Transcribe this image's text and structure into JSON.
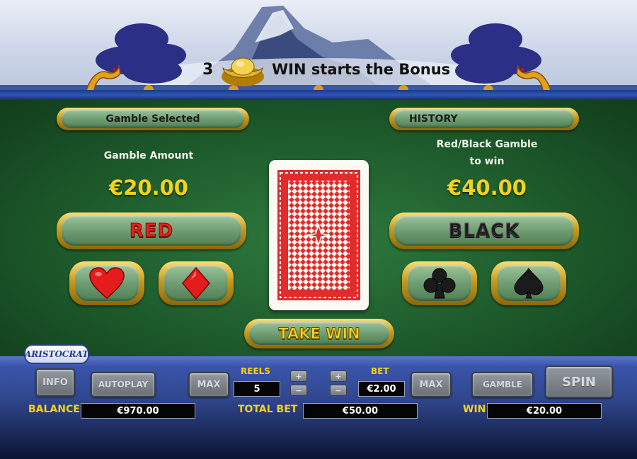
{
  "banner": {
    "count": "3",
    "text": "WIN starts the Bonus",
    "icon": "gold-ingot-icon"
  },
  "gamble": {
    "header_label": "Gamble Selected",
    "history_label": "HISTORY",
    "amount_label": "Gamble Amount",
    "amount_value": "€20.00",
    "to_win_line1": "Red/Black Gamble",
    "to_win_line2": "to win",
    "to_win_value": "€40.00",
    "red_label": "RED",
    "black_label": "BLACK",
    "take_win_label": "TAKE WIN",
    "suits": [
      "heart-icon",
      "diamond-icon",
      "club-icon",
      "spade-icon"
    ]
  },
  "controls": {
    "logo": "ARISTOCRAT",
    "info_label": "INFO",
    "autoplay_label": "AUTOPLAY",
    "max_label": "MAX",
    "reels_label": "REELS",
    "reels_value": "5",
    "bet_label": "BET",
    "bet_value": "€2.00",
    "plus": "+",
    "minus": "−",
    "gamble_label": "GAMBLE",
    "spin_label": "SPIN",
    "balance_label": "BALANCE",
    "balance_value": "€970.00",
    "total_bet_label": "TOTAL BET",
    "total_bet_value": "€50.00",
    "win_label": "WIN",
    "win_value": "€20.00"
  },
  "colors": {
    "felt": "#1d5a2b",
    "gold": "#f2d21c",
    "red": "#e0251c",
    "panel": "#31478f"
  }
}
